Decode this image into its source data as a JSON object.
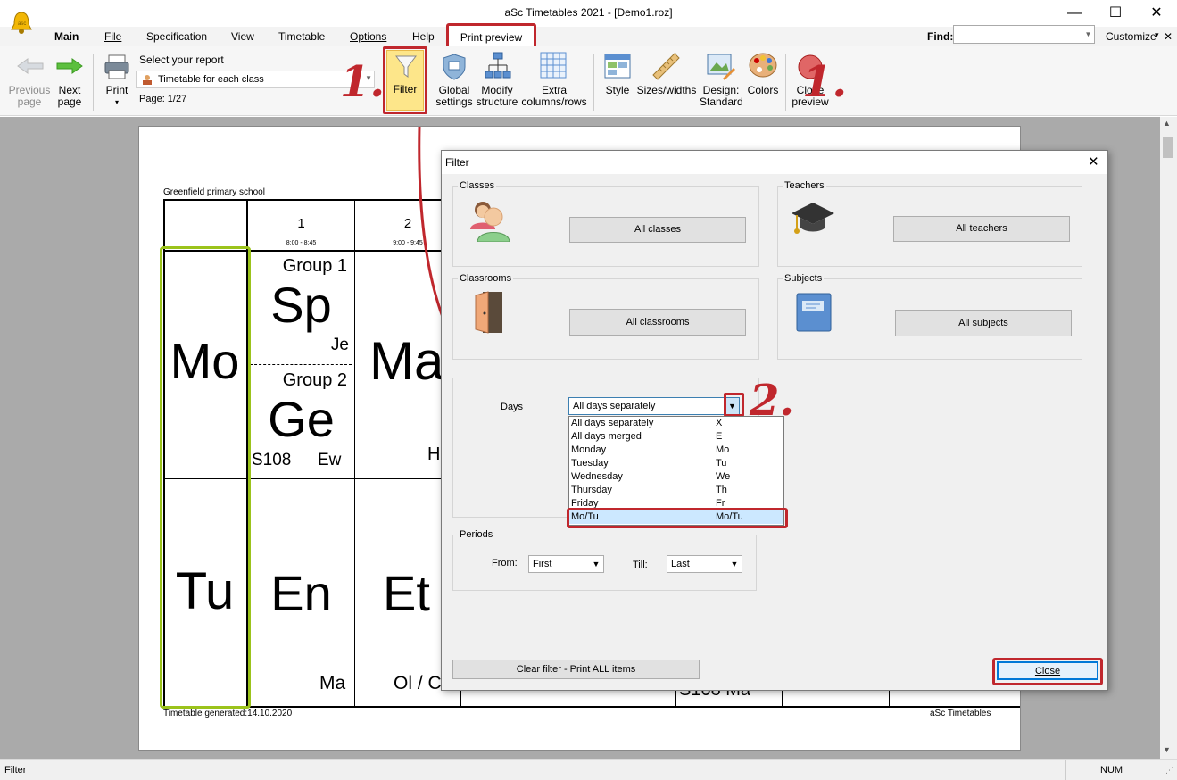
{
  "window": {
    "title": "aSc Timetables 2021  - [Demo1.roz]",
    "minimize": "—",
    "maximize": "☐",
    "close": "✕"
  },
  "menu": {
    "items": [
      "Main",
      "File",
      "Specification",
      "View",
      "Timetable",
      "Options",
      "Help",
      "Print preview"
    ],
    "find_label": "Find:",
    "find_value": "",
    "customize": "Customize",
    "close": "✕"
  },
  "ribbon": {
    "previous": "Previous page",
    "next": "Next page",
    "print": "Print",
    "report_label": "Select your report",
    "report_value": "Timetable for each class",
    "page": "Page: 1/27",
    "filter": "Filter",
    "global_settings": "Global settings",
    "modify_structure": "Modify structure",
    "extra": "Extra columns/rows",
    "style": "Style",
    "sizes": "Sizes/widths",
    "design": "Design: Standard",
    "colors": "Colors",
    "close_preview": "Close preview"
  },
  "preview": {
    "school": "Greenfield primary school",
    "periods": [
      {
        "num": "1",
        "time": "8:00 - 8:45"
      },
      {
        "num": "2",
        "time": "9:00 - 9:45"
      }
    ],
    "days": [
      "Mo",
      "Tu"
    ],
    "mo_p1": {
      "g1": "Group 1",
      "s1": "Sp",
      "t1": "Je",
      "g2": "Group 2",
      "s2": "Ge",
      "room": "S108",
      "t2": "Ew"
    },
    "mo_p2": {
      "subj": "Ma",
      "teacher": "H"
    },
    "tu_p1": {
      "subj": "En",
      "teacher": "Ma"
    },
    "tu_p2": {
      "subj": "Et",
      "teacher": "Ol / C"
    },
    "bottom_partial": "S108    Ma",
    "generated": "Timetable generated:14.10.2020",
    "footer_right": "aSc Timetables"
  },
  "dialog": {
    "title": "Filter",
    "classes": {
      "title": "Classes",
      "button": "All classes"
    },
    "teachers": {
      "title": "Teachers",
      "button": "All teachers"
    },
    "classrooms": {
      "title": "Classrooms",
      "button": "All classrooms"
    },
    "subjects": {
      "title": "Subjects",
      "button": "All subjects"
    },
    "days": {
      "label": "Days",
      "value": "All days separately",
      "options": [
        {
          "name": "All days separately",
          "code": "X"
        },
        {
          "name": "All days merged",
          "code": "E"
        },
        {
          "name": "Monday",
          "code": "Mo"
        },
        {
          "name": "Tuesday",
          "code": "Tu"
        },
        {
          "name": "Wednesday",
          "code": "We"
        },
        {
          "name": "Thursday",
          "code": "Th"
        },
        {
          "name": "Friday",
          "code": "Fr"
        },
        {
          "name": "Mo/Tu",
          "code": "Mo/Tu"
        }
      ]
    },
    "periods": {
      "title": "Periods",
      "from_label": "From:",
      "from_value": "First",
      "till_label": "Till:",
      "till_value": "Last"
    },
    "clear": "Clear filter - Print ALL items",
    "close": "Close"
  },
  "annotations": {
    "one_a": "1.",
    "one_b": "1.",
    "two": "2."
  },
  "status": {
    "left": "Filter",
    "num": "NUM"
  },
  "colors": {
    "annotation_red": "#c0272d",
    "day_highlight": "#9bc31b",
    "filter_active": "#fde68a"
  }
}
